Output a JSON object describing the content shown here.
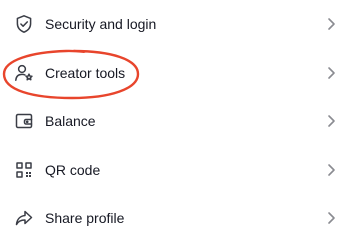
{
  "menu": {
    "items": [
      {
        "label": "Security and login",
        "icon": "shield-check-icon"
      },
      {
        "label": "Creator tools",
        "icon": "user-star-icon"
      },
      {
        "label": "Balance",
        "icon": "wallet-icon"
      },
      {
        "label": "QR code",
        "icon": "qr-code-icon"
      },
      {
        "label": "Share profile",
        "icon": "share-arrow-icon"
      }
    ],
    "chevron_icon": "chevron-right-icon"
  },
  "annotation": {
    "highlight_color": "#e8452c",
    "highlighted_item": "Creator tools"
  },
  "colors": {
    "text": "#161823",
    "icon": "#3a3d46",
    "chevron": "#8a8b91",
    "background": "#ffffff"
  }
}
